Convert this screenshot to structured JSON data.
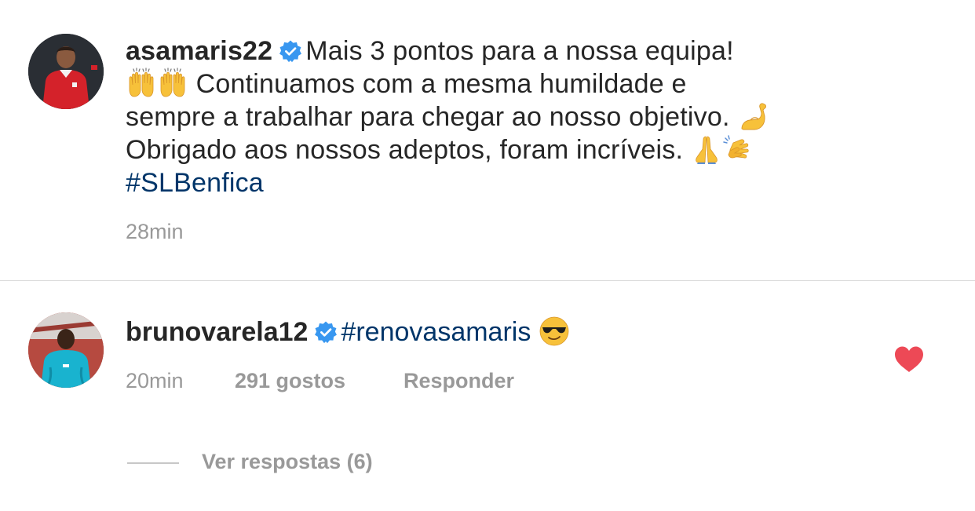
{
  "post": {
    "username": "asamaris22",
    "caption_line1": "Mais 3 pontos para a nossa equipa!",
    "caption_line2": "Continuamos com a mesma humildade e",
    "caption_line3": "sempre a trabalhar para chegar ao nosso objetivo.",
    "caption_line4": "Obrigado aos nossos adeptos, foram incríveis.",
    "hashtag": "#SLBenfica",
    "time": "28min",
    "emoji_names": [
      "raised-hands",
      "raised-hands",
      "flexed-biceps",
      "folded-hands",
      "clapping-hands"
    ]
  },
  "comment": {
    "username": "brunovarela12",
    "hashtag": "#renovasamaris",
    "emoji_name": "sunglasses-face",
    "time": "20min",
    "likes": "291 gostos",
    "reply_label": "Responder",
    "liked": true
  },
  "view_replies": {
    "label": "Ver respostas (6)"
  },
  "colors": {
    "text": "#262626",
    "muted": "#999999",
    "hashtag": "#003569",
    "verified": "#3897f0",
    "heart": "#ed4956",
    "divider": "#dbdbdb"
  }
}
